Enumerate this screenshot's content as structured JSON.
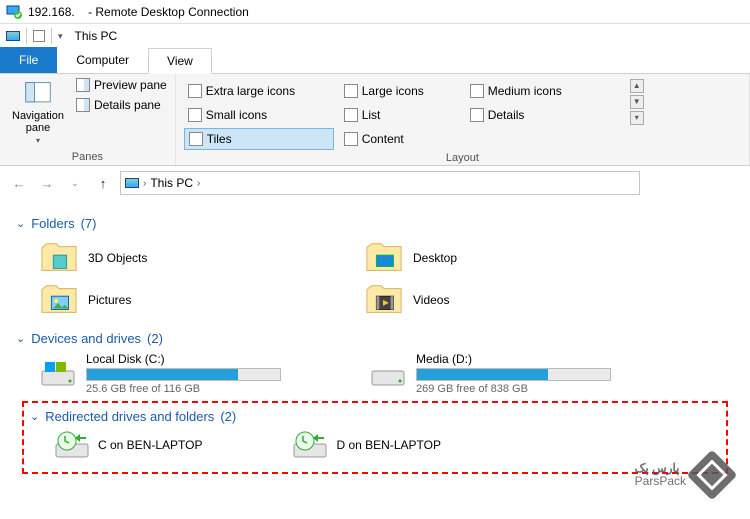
{
  "titlebar": {
    "ip": "192.168.",
    "appname": "- Remote Desktop Connection"
  },
  "quickbar": {
    "location": "This PC"
  },
  "tabs": {
    "file": "File",
    "computer": "Computer",
    "view": "View"
  },
  "ribbon": {
    "panes_group": {
      "nav": "Navigation pane",
      "preview": "Preview pane",
      "details": "Details pane",
      "title": "Panes"
    },
    "layout_group": {
      "cells": [
        [
          "Extra large icons",
          "Large icons",
          "Medium icons"
        ],
        [
          "Small icons",
          "List",
          "Details"
        ],
        [
          "Tiles",
          "Content",
          ""
        ]
      ],
      "selected": "Tiles",
      "title": "Layout"
    }
  },
  "address": {
    "root": "This PC"
  },
  "sections": {
    "folders": {
      "title": "Folders",
      "count": "(7)",
      "items": [
        {
          "name": "3D Objects"
        },
        {
          "name": "Desktop"
        },
        {
          "name": "Pictures"
        },
        {
          "name": "Videos"
        }
      ]
    },
    "devices": {
      "title": "Devices and drives",
      "count": "(2)",
      "items": [
        {
          "name": "Local Disk (C:)",
          "free": "25.6 GB free of 116 GB",
          "pct": 78
        },
        {
          "name": "Media (D:)",
          "free": "269 GB free of 838 GB",
          "pct": 68
        }
      ]
    },
    "redirected": {
      "title": "Redirected drives and folders",
      "count": "(2)",
      "items": [
        {
          "name": "C on BEN-LAPTOP"
        },
        {
          "name": "D on BEN-LAPTOP"
        }
      ]
    }
  },
  "watermark": {
    "line1": "پارس پک",
    "line2": "ParsPack"
  }
}
